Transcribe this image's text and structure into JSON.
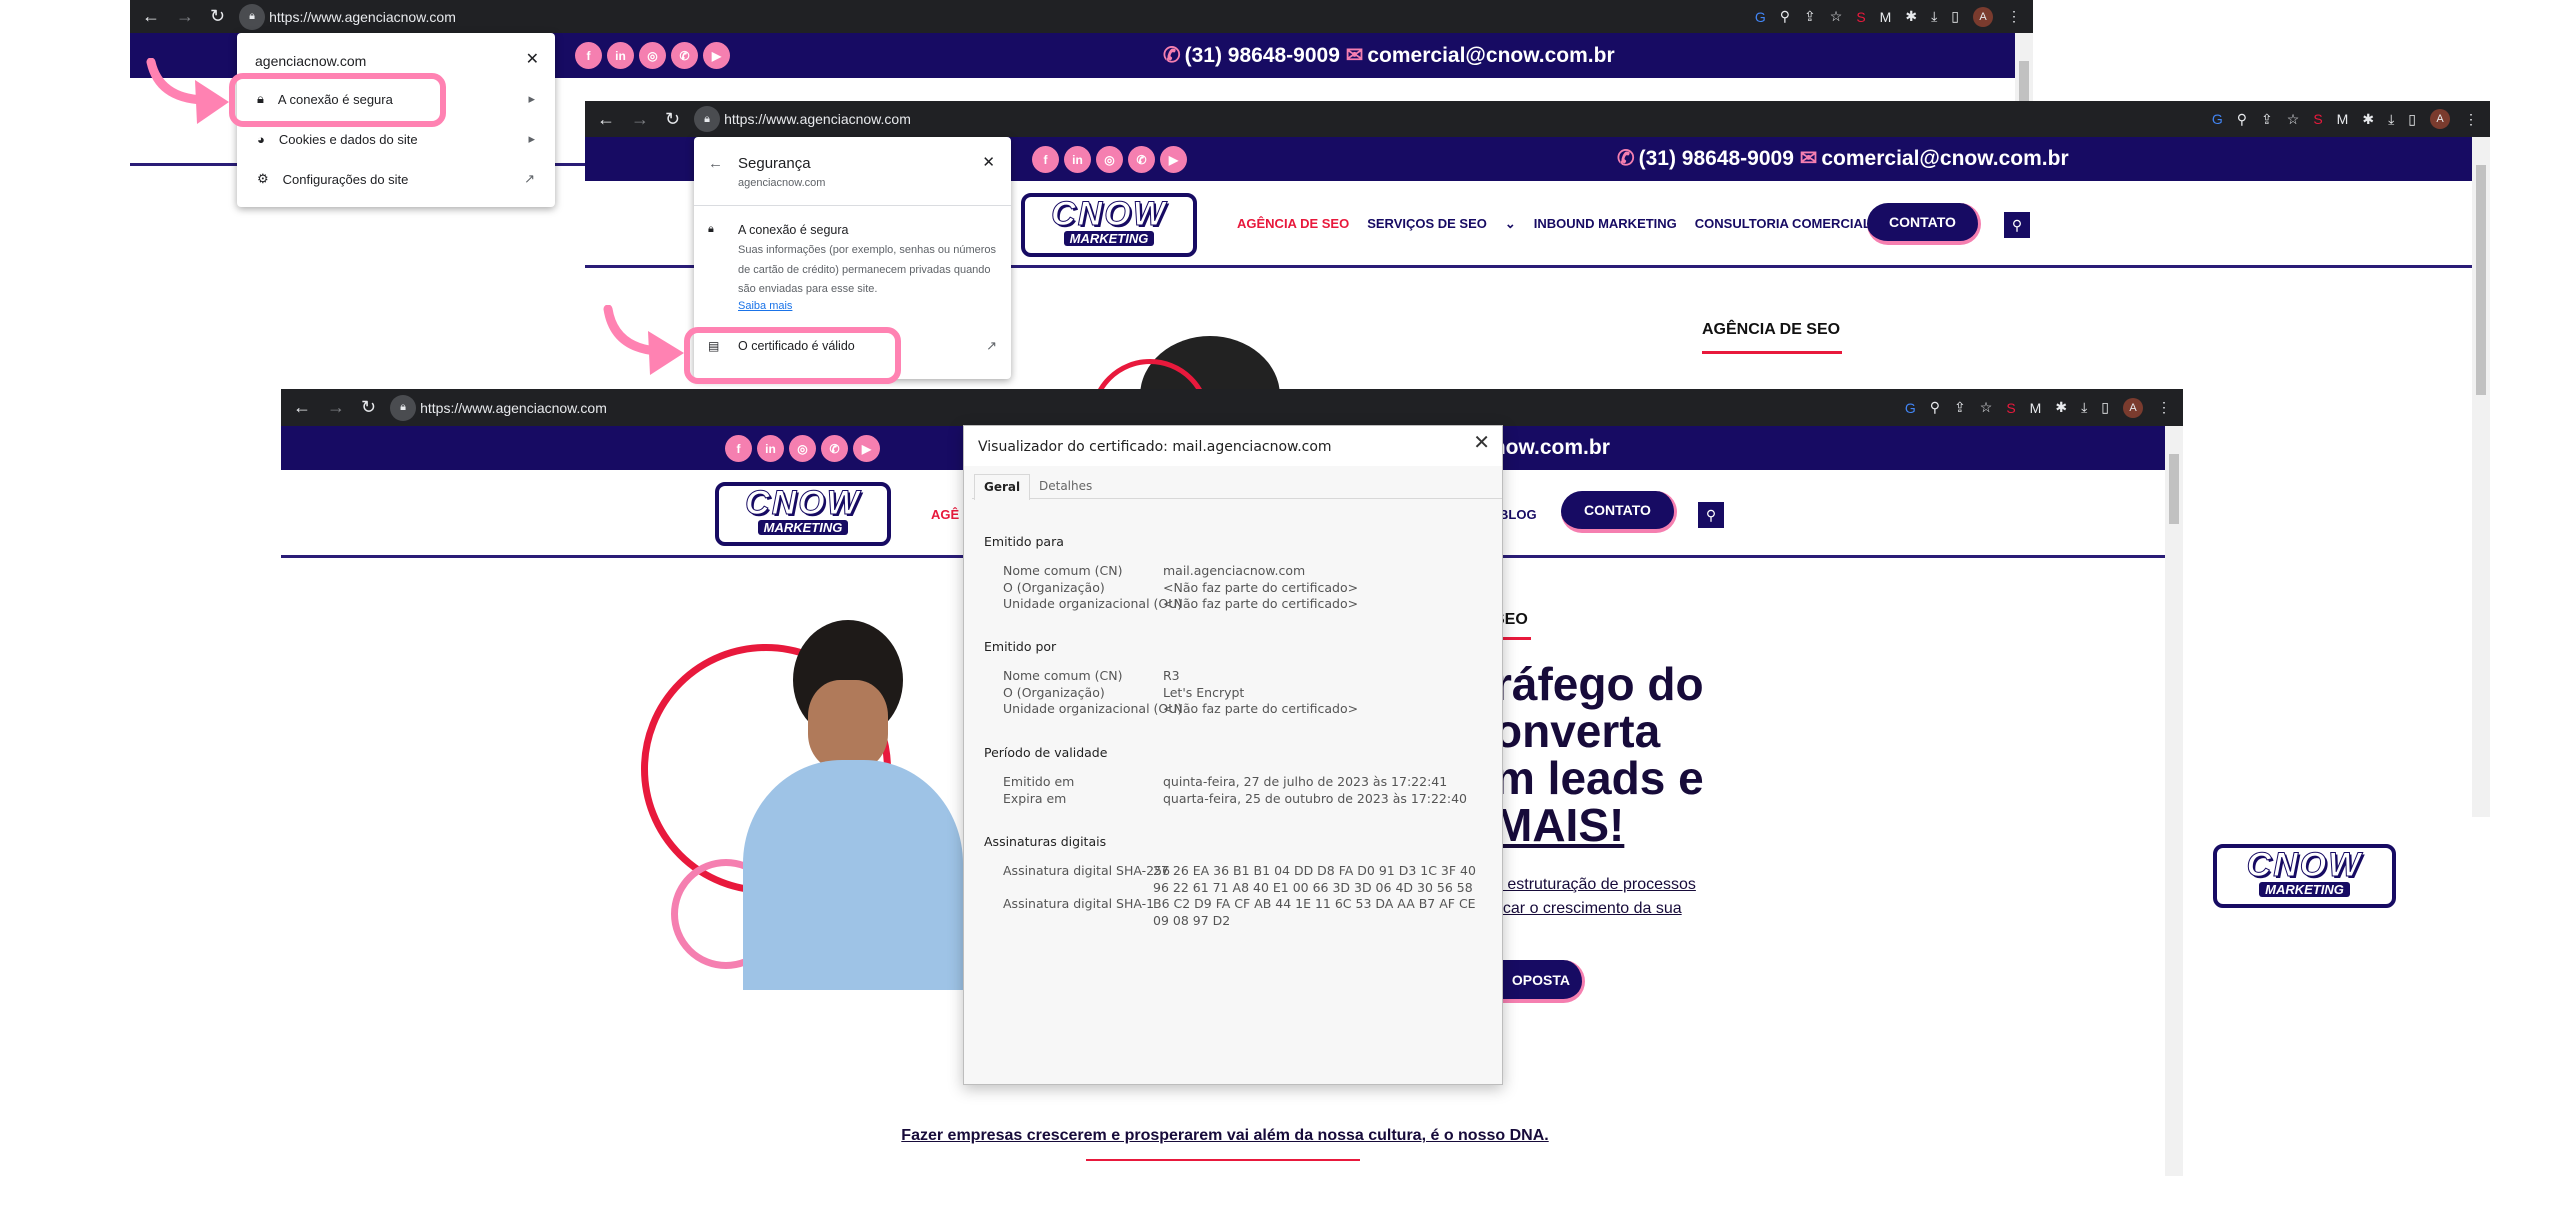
{
  "browser": {
    "url": "https://www.agenciacnow.com",
    "toolbar_icons": [
      "google-icon",
      "zoom-icon",
      "share-icon",
      "star-icon",
      "extension-s-icon",
      "extension-m-icon",
      "puzzle-icon",
      "download-icon",
      "sidepanel-icon",
      "profile-avatar",
      "menu-icon"
    ],
    "avatar_letter": "A"
  },
  "site": {
    "phone": "(31) 98648-9009",
    "email": "comercial@cnow.com.br",
    "social": [
      {
        "icon": "facebook-icon",
        "glyph": "f"
      },
      {
        "icon": "linkedin-icon",
        "glyph": "in"
      },
      {
        "icon": "instagram-icon",
        "glyph": "◎"
      },
      {
        "icon": "whatsapp-icon",
        "glyph": "✆"
      },
      {
        "icon": "youtube-icon",
        "glyph": "▶"
      }
    ],
    "logo_top": "CNOW",
    "logo_bottom": "MARKETING",
    "nav": [
      "AGÊNCIA DE SEO",
      "SERVIÇOS DE SEO",
      "INBOUND MARKETING",
      "CONSULTORIA COMERCIAL",
      "BLOG"
    ],
    "nav_blog": "BLOG",
    "nav_partial": "AGÊ",
    "contact_button": "CONTATO",
    "section_label": "AGÊNCIA DE SEO",
    "section_label_partial": "SEO",
    "hero_lines": [
      "ráfego do",
      "onverta",
      "m leads e",
      "MAIS!"
    ],
    "hero_sub": [
      "n estruturação de processos",
      "ncar o crescimento da sua"
    ],
    "cta_partial": "OPOSTA",
    "footer_tagline": "Fazer empresas crescerem e prosperarem vai além da nossa cultura, é o nosso DNA.",
    "colors": {
      "brand_navy": "#170b63",
      "brand_pink": "#f57fb0",
      "accent_red": "#e8193c",
      "highlight": "#ff82b2"
    }
  },
  "site_info_popup": {
    "domain": "agenciacnow.com",
    "items": [
      {
        "label": "A conexão é segura",
        "icon": "lock-icon"
      },
      {
        "label": "Cookies e dados do site",
        "icon": "cookie-icon"
      },
      {
        "label": "Configurações do site",
        "icon": "gear-icon"
      }
    ]
  },
  "security_popup": {
    "title": "Segurança",
    "domain": "agenciacnow.com",
    "heading": "A conexão é segura",
    "body": "Suas informações (por exemplo, senhas ou números de cartão de crédito) permanecem privadas quando são enviadas para esse site.",
    "learn_more": "Saiba mais",
    "certificate": "O certificado é válido"
  },
  "cert_viewer": {
    "title": "Visualizador do certificado: mail.agenciacnow.com",
    "tabs": [
      "Geral",
      "Detalhes"
    ],
    "sections": [
      {
        "title": "Emitido para",
        "rows": [
          [
            "Nome comum (CN)",
            "mail.agenciacnow.com"
          ],
          [
            "O (Organização)",
            "<Não faz parte do certificado>"
          ],
          [
            "Unidade organizacional (OU)",
            "<Não faz parte do certificado>"
          ]
        ]
      },
      {
        "title": "Emitido por",
        "rows": [
          [
            "Nome comum (CN)",
            "R3"
          ],
          [
            "O (Organização)",
            "Let's Encrypt"
          ],
          [
            "Unidade organizacional (OU)",
            "<Não faz parte do certificado>"
          ]
        ]
      },
      {
        "title": "Período de validade",
        "rows": [
          [
            "Emitido em",
            "quinta-feira, 27 de julho de 2023 às 17:22:41"
          ],
          [
            "Expira em",
            "quarta-feira, 25 de outubro de 2023 às 17:22:40"
          ]
        ]
      },
      {
        "title": "Assinaturas digitais",
        "rows": [
          [
            "Assinatura digital SHA-256",
            "27 26 EA 36 B1 B1 04 DD D8 FA D0 91 D3 1C 3F 40",
            "96 22 61 71 A8 40 E1 00 66 3D 3D 06 4D 30 56 58"
          ],
          [
            "Assinatura digital SHA-1",
            "B6 C2 D9 FA CF AB 44 1E 11 6C 53 DA AA B7 AF CE",
            "09 08 97 D2"
          ]
        ]
      }
    ]
  }
}
